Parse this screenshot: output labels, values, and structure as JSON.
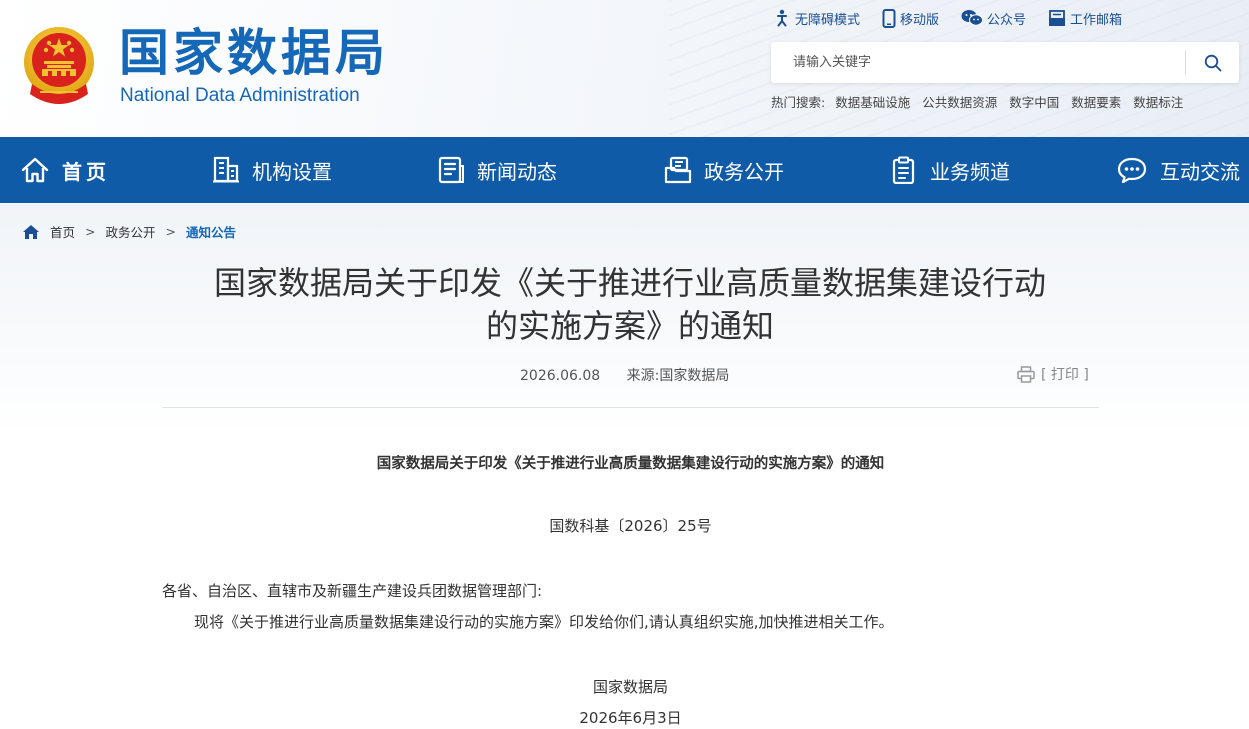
{
  "header": {
    "logo_cn": "国家数据局",
    "logo_en": "National Data Administration",
    "top_links": [
      {
        "label": "无障碍模式",
        "icon": "accessibility-icon"
      },
      {
        "label": "移动版",
        "icon": "mobile-icon"
      },
      {
        "label": "公众号",
        "icon": "wechat-icon"
      },
      {
        "label": "工作邮箱",
        "icon": "mail-icon"
      }
    ],
    "search": {
      "placeholder": "请输入关键字"
    },
    "hot_search": {
      "label": "热门搜索:",
      "items": [
        "数据基础设施",
        "公共数据资源",
        "数字中国",
        "数据要素",
        "数据标注"
      ]
    }
  },
  "nav": {
    "items": [
      {
        "label": "首页",
        "icon": "home-icon"
      },
      {
        "label": "机构设置",
        "icon": "building-icon"
      },
      {
        "label": "新闻动态",
        "icon": "news-icon"
      },
      {
        "label": "政务公开",
        "icon": "folder-icon"
      },
      {
        "label": "业务频道",
        "icon": "clipboard-icon"
      },
      {
        "label": "互动交流",
        "icon": "chat-icon"
      }
    ]
  },
  "breadcrumb": {
    "items": [
      "首页",
      "政务公开"
    ],
    "separator": ">",
    "current": "通知公告"
  },
  "article": {
    "title_line1": "国家数据局关于印发《关于推进行业高质量数据集建设行动",
    "title_line2": "的实施方案》的通知",
    "date": "2026.06.08",
    "source": "来源:国家数据局",
    "print_label": "[ 打印 ]",
    "doc_title": "国家数据局关于印发《关于推进行业高质量数据集建设行动的实施方案》的通知",
    "doc_number": "国数科基〔2026〕25号",
    "salutation": "各省、自治区、直辖市及新疆生产建设兵团数据管理部门:",
    "paragraph": "现将《关于推进行业高质量数据集建设行动的实施方案》印发给你们,请认真组织实施,加快推进相关工作。",
    "signature_org": "国家数据局",
    "signature_date": "2026年6月3日"
  },
  "colors": {
    "brand_blue": "#1567b8",
    "nav_blue": "#0f5ba8",
    "emblem_red": "#d9221c",
    "emblem_gold": "#f2c230"
  }
}
